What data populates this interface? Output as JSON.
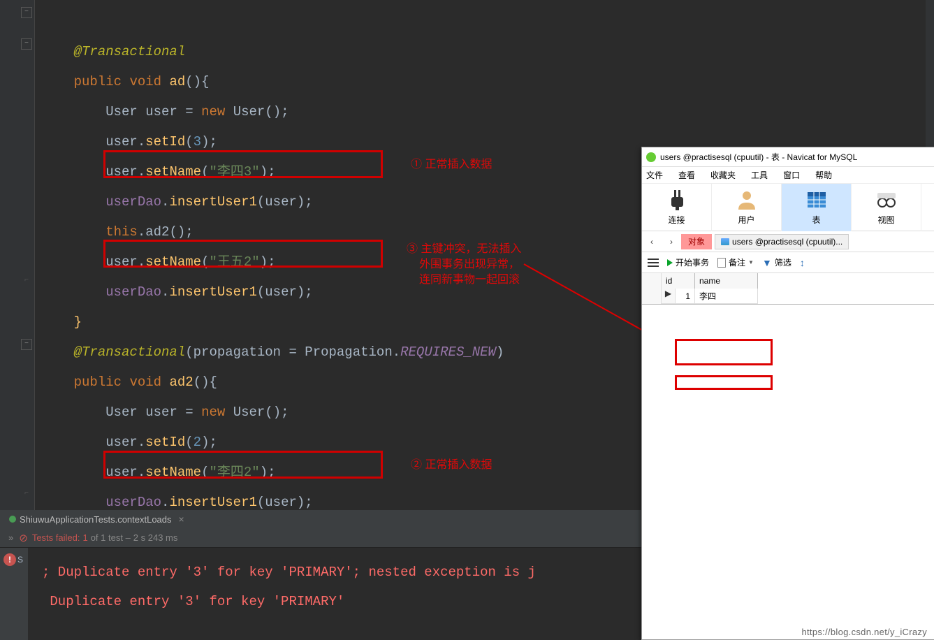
{
  "code": {
    "ann_trans": "@Transactional",
    "kw_public": "public",
    "kw_void": "void",
    "fn_ad": "ad",
    "type_user": "User",
    "var_user": "user",
    "kw_new": "new",
    "ctor_user": "User",
    "m_setId": "setId",
    "num_3": "3",
    "m_setName": "setName",
    "str_lisi3": "\"李四3\"",
    "id_userDao": "userDao",
    "m_insertUser1": "insertUser1",
    "kw_this": "this",
    "m_ad2": "ad2",
    "str_wangwu2": "\"王五2\"",
    "ann_trans2": "@Transactional",
    "param_propagation": "propagation",
    "eq": " = ",
    "cls_propagation": "Propagation",
    "const_requires_new": "REQUIRES_NEW",
    "fn_ad2": "ad2",
    "num_2": "2",
    "str_lisi2": "\"李四2\""
  },
  "tab": {
    "title": "ShiuwuApplicationTests.contextLoads"
  },
  "status": {
    "prefix": "Tests failed:",
    "count": "1",
    "of": "of 1 test –",
    "time": "2 s 243 ms"
  },
  "console": {
    "s": "S",
    "line1_a": "; Duplicate entry '3' for key 'PRIMARY'; nested exception is j",
    "line2": "Duplicate entry '3' for key 'PRIMARY'"
  },
  "navicat": {
    "title": "users @practisesql (cpuutil) - 表 - Navicat for MySQL",
    "menu": [
      "文件",
      "查看",
      "收藏夹",
      "工具",
      "窗口",
      "帮助"
    ],
    "tools": {
      "conn": "连接",
      "user": "用户",
      "table": "表",
      "view": "视图"
    },
    "obj_tab": "对象",
    "users_tab": "users @practisesql (cpuutil)...",
    "action_start": "开始事务",
    "action_note": "备注",
    "action_filter": "筛选",
    "col_id": "id",
    "col_name": "name",
    "row1_id": "1",
    "row1_name": "李四"
  },
  "notes": {
    "n1": "① 正常插入数据",
    "n3a": "③ 主键冲突，无法插入",
    "n3b": "外围事务出现异常，",
    "n3c": "连同新事物一起回滚",
    "n2": "② 正常插入数据"
  },
  "watermark": "https://blog.csdn.net/y_iCrazy"
}
